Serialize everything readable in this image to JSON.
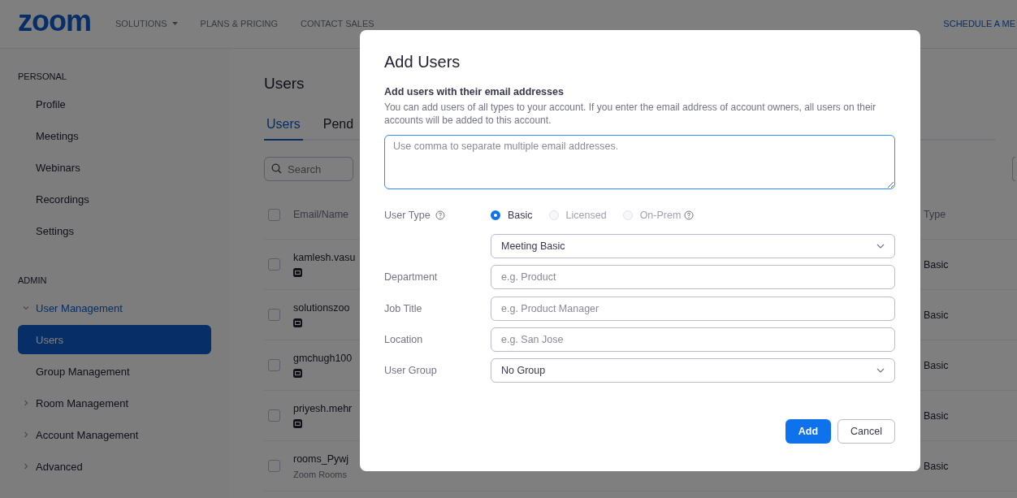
{
  "nav": {
    "logo": "zoom",
    "links": [
      {
        "label": "SOLUTIONS",
        "dropdown": true
      },
      {
        "label": "PLANS & PRICING",
        "dropdown": false
      },
      {
        "label": "CONTACT SALES",
        "dropdown": false
      }
    ],
    "cta": "SCHEDULE A ME"
  },
  "sidebar": {
    "sections": [
      {
        "heading": "PERSONAL",
        "items": [
          {
            "label": "Profile",
            "selected": false
          },
          {
            "label": "Meetings",
            "selected": false
          },
          {
            "label": "Webinars",
            "selected": false
          },
          {
            "label": "Recordings",
            "selected": false
          },
          {
            "label": "Settings",
            "selected": false
          }
        ]
      },
      {
        "heading": "ADMIN",
        "items": [
          {
            "label": "User Management",
            "selected": false,
            "expanded": true,
            "children": [
              {
                "label": "Users",
                "selected": true
              },
              {
                "label": "Group Management",
                "selected": false
              }
            ]
          },
          {
            "label": "Room Management",
            "selected": false,
            "expanded": false
          },
          {
            "label": "Account Management",
            "selected": false,
            "expanded": false
          },
          {
            "label": "Advanced",
            "selected": false,
            "expanded": false
          }
        ]
      }
    ]
  },
  "main": {
    "title": "Users",
    "tabs": [
      {
        "label": "Users",
        "selected": true
      },
      {
        "label": "Pend",
        "selected": false
      }
    ],
    "search": {
      "placeholder": "Search"
    },
    "table": {
      "columns": [
        "Email/Name",
        "Type"
      ],
      "all_checked": false,
      "rows": [
        {
          "email": "kamlesh.vasu",
          "kind": "icon",
          "type": "Basic",
          "checked": false
        },
        {
          "email": "solutionszoo",
          "kind": "icon",
          "type": "Basic",
          "checked": false
        },
        {
          "email": "gmchugh100",
          "kind": "icon",
          "type": "Basic",
          "checked": false
        },
        {
          "email": "priyesh.mehr",
          "kind": "icon",
          "type": "Basic",
          "checked": false
        },
        {
          "email": "rooms_Pywj",
          "kind": "text",
          "subtitle": "Zoom Rooms",
          "type": "Basic",
          "checked": false
        }
      ]
    }
  },
  "modal": {
    "title": "Add Users",
    "subtitle": "Add users with their email addresses",
    "description": "You can add users of all types to your account. If you enter the email address of account owners, all users on their accounts will be added to this account.",
    "emails": {
      "placeholder": "Use comma to separate multiple email addresses.",
      "focused": true
    },
    "user_type": {
      "label": "User Type",
      "options": [
        {
          "label": "Basic",
          "selected": true,
          "disabled": false,
          "help": false
        },
        {
          "label": "Licensed",
          "selected": false,
          "disabled": true,
          "help": false
        },
        {
          "label": "On-Prem",
          "selected": false,
          "disabled": true,
          "help": true
        }
      ],
      "plan": "Meeting Basic"
    },
    "fields": [
      {
        "label": "Department",
        "kind": "input",
        "placeholder": "e.g. Product"
      },
      {
        "label": "Job Title",
        "kind": "input",
        "placeholder": "e.g. Product Manager"
      },
      {
        "label": "Location",
        "kind": "input",
        "placeholder": "e.g. San Jose"
      },
      {
        "label": "User Group",
        "kind": "select",
        "value": "No Group"
      }
    ],
    "buttons": [
      {
        "label": "Add",
        "kind": "primary"
      },
      {
        "label": "Cancel",
        "kind": "secondary"
      }
    ]
  }
}
